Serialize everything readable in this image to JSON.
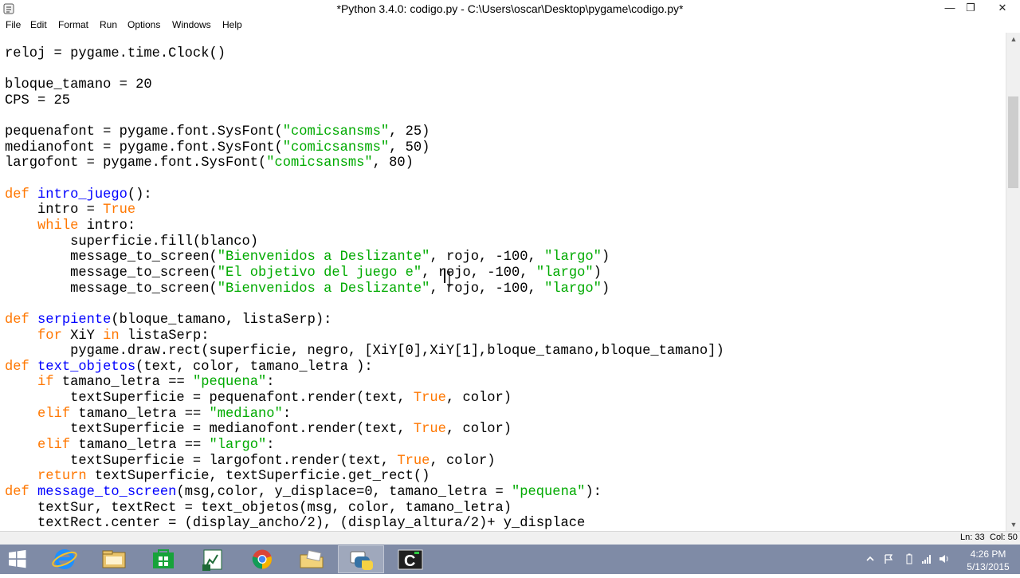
{
  "window": {
    "title": "*Python 3.4.0: codigo.py - C:\\Users\\oscar\\Desktop\\pygame\\codigo.py*",
    "controls": {
      "minimize": "—",
      "maximize": "❐",
      "close": "✕"
    }
  },
  "menu": [
    "File",
    "Edit",
    "Format",
    "Run",
    "Options",
    "Windows",
    "Help"
  ],
  "code": {
    "lines": [
      [
        [
          "t",
          "reloj = pygame.time.Clock()"
        ]
      ],
      [],
      [
        [
          "t",
          "bloque_tamano = 20"
        ]
      ],
      [
        [
          "t",
          "CPS = 25"
        ]
      ],
      [],
      [
        [
          "t",
          "pequenafont = pygame.font.SysFont("
        ],
        [
          "s",
          "\"comicsansms\""
        ],
        [
          "t",
          ", 25)"
        ]
      ],
      [
        [
          "t",
          "medianofont = pygame.font.SysFont("
        ],
        [
          "s",
          "\"comicsansms\""
        ],
        [
          "t",
          ", 50)"
        ]
      ],
      [
        [
          "t",
          "largofont = pygame.font.SysFont("
        ],
        [
          "s",
          "\"comicsansms\""
        ],
        [
          "t",
          ", 80)"
        ]
      ],
      [],
      [
        [
          "k",
          "def"
        ],
        [
          "t",
          " "
        ],
        [
          "d",
          "intro_juego"
        ],
        [
          "t",
          "():"
        ]
      ],
      [
        [
          "t",
          "    intro = "
        ],
        [
          "k",
          "True"
        ]
      ],
      [
        [
          "t",
          "    "
        ],
        [
          "k",
          "while"
        ],
        [
          "t",
          " intro:"
        ]
      ],
      [
        [
          "t",
          "        superficie.fill(blanco)"
        ]
      ],
      [
        [
          "t",
          "        message_to_screen("
        ],
        [
          "s",
          "\"Bienvenidos a Deslizante\""
        ],
        [
          "t",
          ", rojo, -100, "
        ],
        [
          "s",
          "\"largo\""
        ],
        [
          "t",
          ")"
        ]
      ],
      [
        [
          "t",
          "        message_to_screen("
        ],
        [
          "s",
          "\"El objetivo del juego e"
        ],
        [
          "s",
          "\""
        ],
        [
          "t",
          ", rojo, -100, "
        ],
        [
          "s",
          "\"largo\""
        ],
        [
          "t",
          ")"
        ]
      ],
      [
        [
          "t",
          "        message_to_screen("
        ],
        [
          "s",
          "\"Bienvenidos a Deslizante\""
        ],
        [
          "t",
          ", rojo, -100, "
        ],
        [
          "s",
          "\"largo\""
        ],
        [
          "t",
          ")"
        ]
      ],
      [],
      [
        [
          "k",
          "def"
        ],
        [
          "t",
          " "
        ],
        [
          "d",
          "serpiente"
        ],
        [
          "t",
          "(bloque_tamano, listaSerp):"
        ]
      ],
      [
        [
          "t",
          "    "
        ],
        [
          "k",
          "for"
        ],
        [
          "t",
          " XiY "
        ],
        [
          "k",
          "in"
        ],
        [
          "t",
          " listaSerp:"
        ]
      ],
      [
        [
          "t",
          "        pygame.draw.rect(superficie, negro, [XiY[0],XiY[1],bloque_tamano,bloque_tamano])"
        ]
      ],
      [
        [
          "k",
          "def"
        ],
        [
          "t",
          " "
        ],
        [
          "d",
          "text_objetos"
        ],
        [
          "t",
          "(text, color, tamano_letra ):"
        ]
      ],
      [
        [
          "t",
          "    "
        ],
        [
          "k",
          "if"
        ],
        [
          "t",
          " tamano_letra == "
        ],
        [
          "s",
          "\"pequena\""
        ],
        [
          "t",
          ":"
        ]
      ],
      [
        [
          "t",
          "        textSuperficie = pequenafont.render(text, "
        ],
        [
          "k",
          "True"
        ],
        [
          "t",
          ", color)"
        ]
      ],
      [
        [
          "t",
          "    "
        ],
        [
          "k",
          "elif"
        ],
        [
          "t",
          " tamano_letra == "
        ],
        [
          "s",
          "\"mediano\""
        ],
        [
          "t",
          ":"
        ]
      ],
      [
        [
          "t",
          "        textSuperficie = medianofont.render(text, "
        ],
        [
          "k",
          "True"
        ],
        [
          "t",
          ", color)"
        ]
      ],
      [
        [
          "t",
          "    "
        ],
        [
          "k",
          "elif"
        ],
        [
          "t",
          " tamano_letra == "
        ],
        [
          "s",
          "\"largo\""
        ],
        [
          "t",
          ":"
        ]
      ],
      [
        [
          "t",
          "        textSuperficie = largofont.render(text, "
        ],
        [
          "k",
          "True"
        ],
        [
          "t",
          ", color)"
        ]
      ],
      [
        [
          "t",
          "    "
        ],
        [
          "k",
          "return"
        ],
        [
          "t",
          " textSuperficie, textSuperficie.get_rect()"
        ]
      ],
      [
        [
          "k",
          "def"
        ],
        [
          "t",
          " "
        ],
        [
          "d",
          "message_to_screen"
        ],
        [
          "t",
          "(msg,color, y_displace=0, tamano_letra = "
        ],
        [
          "s",
          "\"pequena\""
        ],
        [
          "t",
          "):"
        ]
      ],
      [
        [
          "t",
          "    textSur, textRect = text_objetos(msg, color, tamano_letra)"
        ]
      ],
      [
        [
          "t",
          "    textRect.center = (display_ancho/2), (display_altura/2)+ y_displace"
        ]
      ]
    ],
    "colors": {
      "keyword": "#ff7700",
      "string": "#00aa00",
      "definition": "#0000ff",
      "default": "#000000"
    }
  },
  "status": {
    "line": "Ln: 33",
    "col": "Col: 50"
  },
  "taskbar": {
    "items": [
      "start-button",
      "internet-explorer",
      "file-explorer",
      "store",
      "excel",
      "chrome",
      "folder",
      "python-idle",
      "terminal"
    ],
    "clock": {
      "time": "4:26 PM",
      "date": "5/13/2015"
    }
  }
}
